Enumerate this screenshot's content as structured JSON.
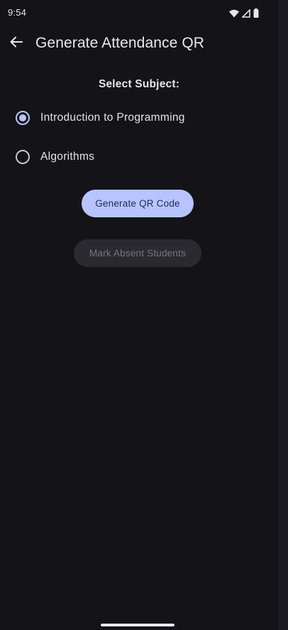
{
  "status_bar": {
    "time": "9:54",
    "icons": [
      "wifi-icon",
      "cell-signal-icon",
      "battery-icon"
    ]
  },
  "app_bar": {
    "back_icon": "arrow-back-icon",
    "title": "Generate Attendance QR"
  },
  "form": {
    "section_label": "Select Subject:",
    "subjects": [
      {
        "label": "Introduction to Programming",
        "selected": true
      },
      {
        "label": "Algorithms",
        "selected": false
      }
    ]
  },
  "actions": {
    "generate_label": "Generate QR Code",
    "mark_absent_label": "Mark Absent Students",
    "mark_absent_enabled": false
  },
  "colors": {
    "background": "#131318",
    "accent": "#b7c4ff",
    "on_accent": "#1d2b5e",
    "disabled_bg": "#2a2a30",
    "disabled_text": "#75757d"
  }
}
